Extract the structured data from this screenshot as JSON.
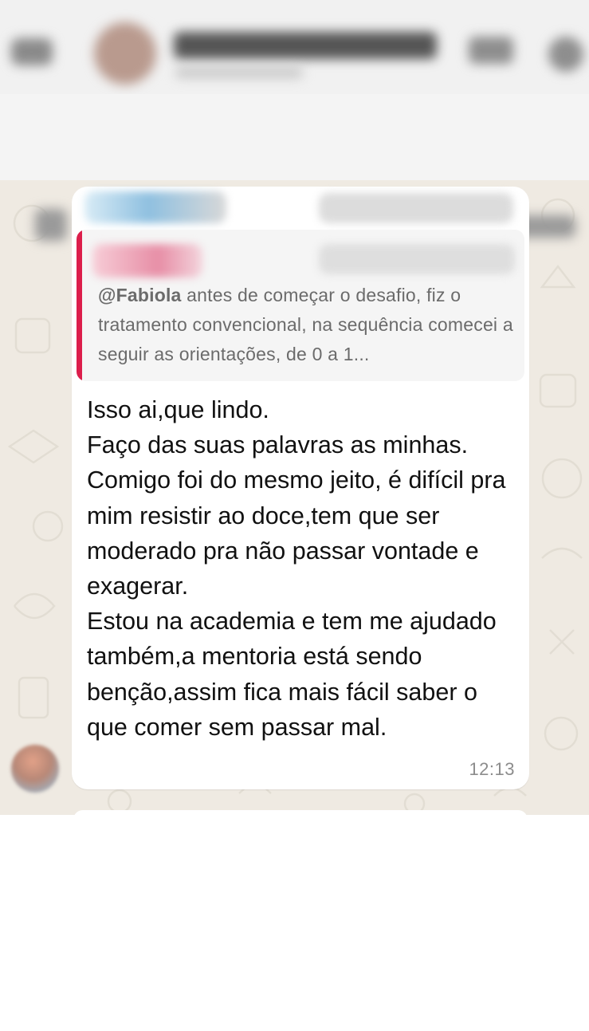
{
  "message": {
    "quote": {
      "mention": "@Fabiola",
      "text": " antes de começar o desafio, fiz o tratamento convencional, na sequência comecei a seguir as orientações, de 0 a 1..."
    },
    "body": "Isso ai,que lindo.\nFaço das suas palavras as minhas.\nComigo foi do mesmo jeito, é difícil pra mim resistir ao doce,tem que ser moderado pra não passar vontade e exagerar.\nEstou na academia e tem me ajudado também,a mentoria está sendo benção,assim fica mais fácil saber o que comer sem passar mal.",
    "time": "12:13"
  },
  "colors": {
    "chat_background": "#efeae2",
    "bubble": "#ffffff",
    "quote_accent": "#dc1e4b",
    "sender_name": "#8fc0e0"
  },
  "icons": [
    "back-arrow-icon",
    "video-call-icon",
    "phone-icon",
    "pin-icon"
  ]
}
